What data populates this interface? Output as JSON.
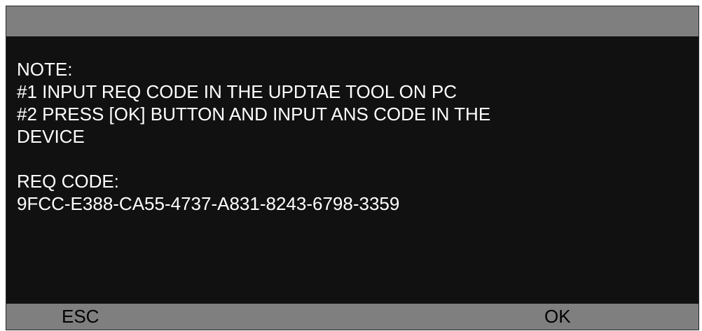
{
  "header": {
    "title": ""
  },
  "note": {
    "heading": "NOTE:",
    "steps": [
      "#1 INPUT REQ CODE IN THE UPDTAE TOOL ON PC",
      "#2 PRESS [OK] BUTTON AND INPUT ANS CODE IN THE",
      "DEVICE"
    ]
  },
  "request": {
    "label": "REQ CODE:",
    "code": "9FCC-E388-CA55-4737-A831-8243-6798-3359"
  },
  "softkeys": {
    "left_label": "ESC",
    "right_label": "OK"
  },
  "colors": {
    "screen_background": "#111111",
    "bar_background": "#7f7f7f",
    "text": "#ffffff",
    "softkey_text": "#000000"
  }
}
